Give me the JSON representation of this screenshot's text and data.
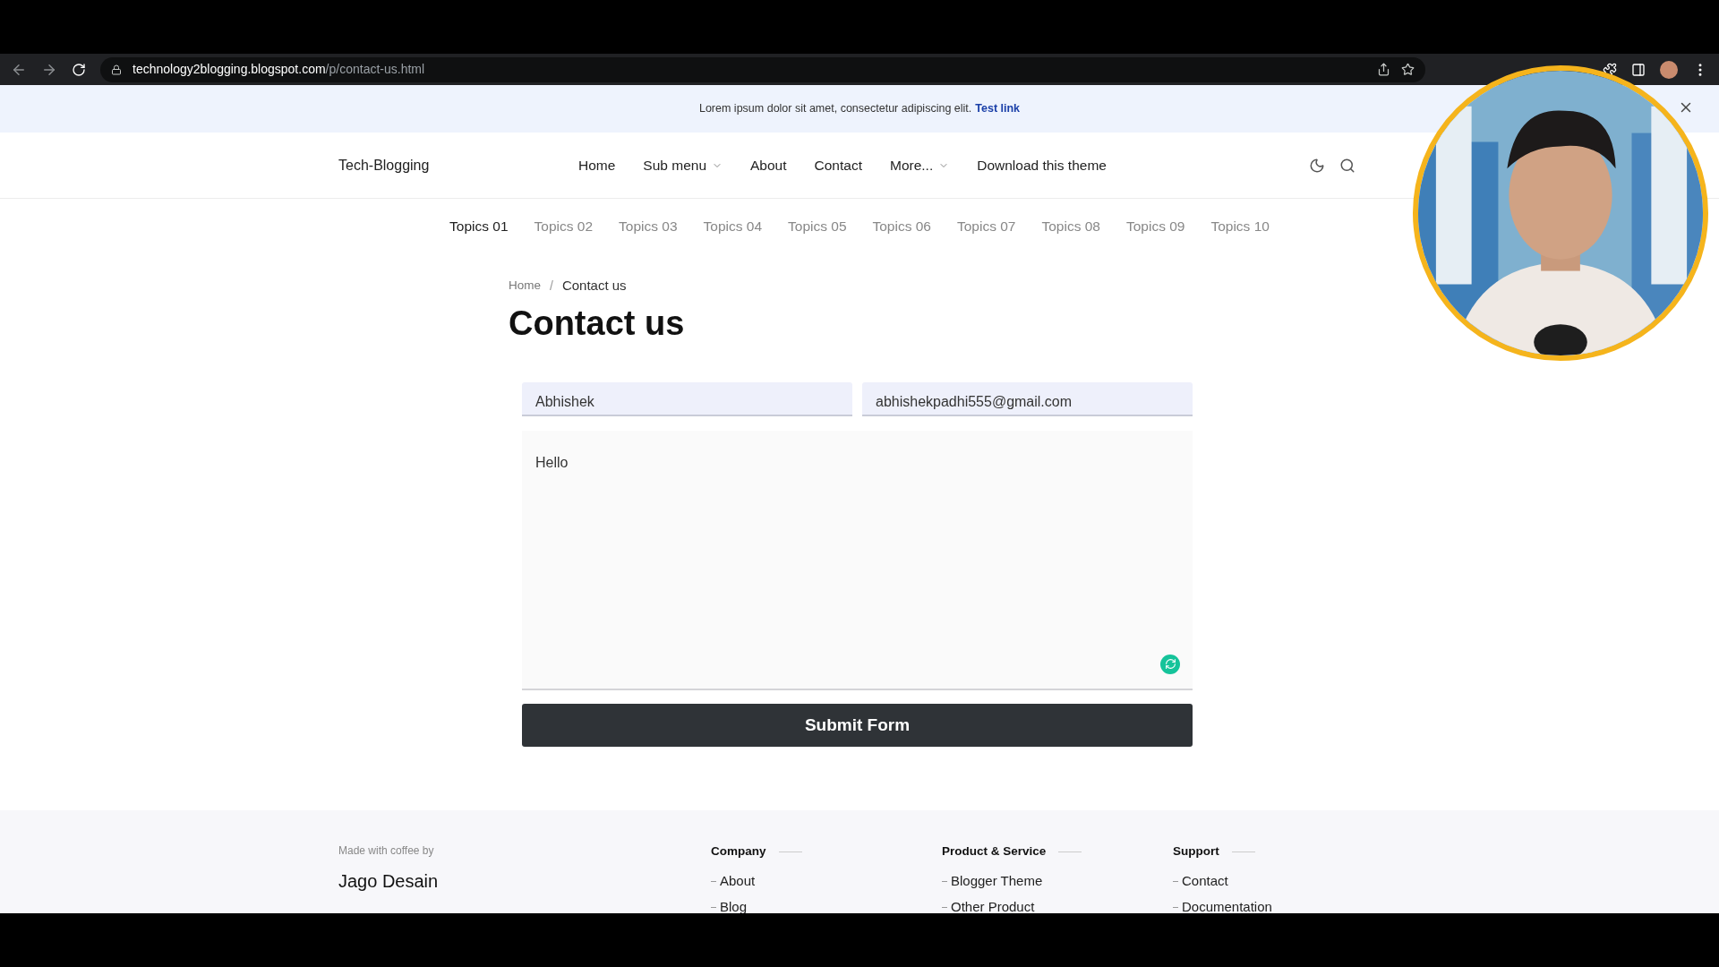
{
  "browser": {
    "url_host": "technology2blogging.blogspot.com",
    "url_path": "/p/contact-us.html"
  },
  "banner": {
    "text": "Lorem ipsum dolor sit amet, consectetur adipiscing elit.",
    "link": "Test link"
  },
  "header": {
    "logo": "Tech-Blogging",
    "nav": [
      {
        "label": "Home",
        "has_menu": false
      },
      {
        "label": "Sub menu",
        "has_menu": true
      },
      {
        "label": "About",
        "has_menu": false
      },
      {
        "label": "Contact",
        "has_menu": false
      },
      {
        "label": "More...",
        "has_menu": true
      },
      {
        "label": "Download this theme",
        "has_menu": false
      }
    ]
  },
  "topics": [
    {
      "label": "Topics 01",
      "selected": true
    },
    {
      "label": "Topics 02",
      "selected": false
    },
    {
      "label": "Topics 03",
      "selected": false
    },
    {
      "label": "Topics 04",
      "selected": false
    },
    {
      "label": "Topics 05",
      "selected": false
    },
    {
      "label": "Topics 06",
      "selected": false
    },
    {
      "label": "Topics 07",
      "selected": false
    },
    {
      "label": "Topics 08",
      "selected": false
    },
    {
      "label": "Topics 09",
      "selected": false
    },
    {
      "label": "Topics 10",
      "selected": false
    }
  ],
  "breadcrumb": [
    "Home",
    "/",
    "Contact us"
  ],
  "page_title": "Contact us",
  "form": {
    "name_value": "Abhishek",
    "email_value": "abhishekpadhi555@gmail.com",
    "message_value": "Hello",
    "submit": "Submit Form"
  },
  "footer": {
    "made_with": "Made with coffee by",
    "brand": "Jago Desain",
    "columns": [
      {
        "heading": "Company",
        "links": [
          "About",
          "Blog"
        ]
      },
      {
        "heading": "Product & Service",
        "links": [
          "Blogger Theme",
          "Other Product"
        ]
      },
      {
        "heading": "Support",
        "links": [
          "Contact",
          "Documentation"
        ]
      }
    ]
  }
}
